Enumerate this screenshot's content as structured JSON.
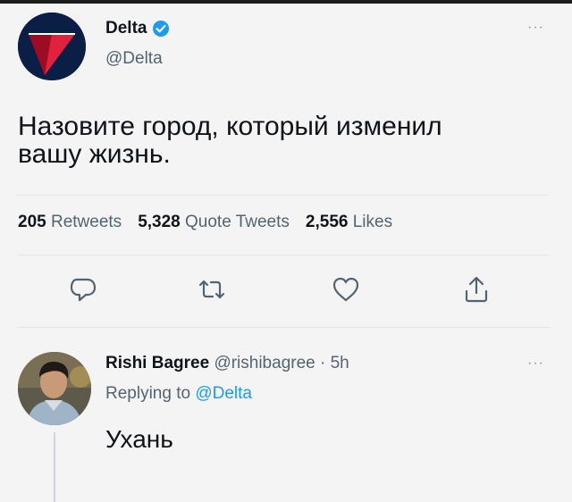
{
  "tweet": {
    "author_name": "Delta",
    "author_handle": "@Delta",
    "more_label": "···",
    "text_line1": "Назовите город, который изменил",
    "text_line2": "вашу жизнь.",
    "stats": {
      "retweets_count": "205",
      "retweets_label": "Retweets",
      "quote_count": "5,328",
      "quote_label": "Quote Tweets",
      "likes_count": "2,556",
      "likes_label": "Likes"
    },
    "actions": [
      "reply-icon",
      "retweet-icon",
      "like-icon",
      "share-icon"
    ]
  },
  "reply": {
    "author_name": "Rishi Bagree",
    "meta": "@rishibagree · 5h",
    "more_label": "···",
    "replying_prefix": "Replying to",
    "replying_mention": "@Delta",
    "text": "Ухань"
  },
  "colors": {
    "text": "#0f1419",
    "secondary": "#536471",
    "accent": "#1d9bf0",
    "delta_red": "#c8102e",
    "delta_navy": "#0b1f46"
  }
}
